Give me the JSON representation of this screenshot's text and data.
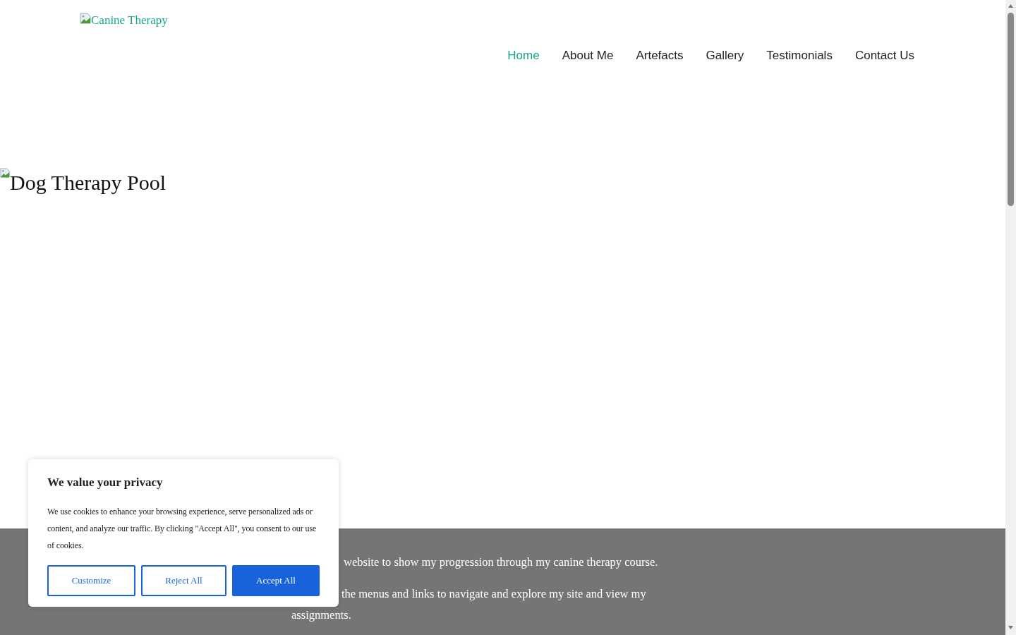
{
  "header": {
    "logo_alt": "Canine Therapy",
    "nav": [
      {
        "label": "Home",
        "selected": true
      },
      {
        "label": "About Me",
        "selected": false
      },
      {
        "label": "Artefacts",
        "selected": false
      },
      {
        "label": "Gallery",
        "selected": false
      },
      {
        "label": "Testimonials",
        "selected": false
      },
      {
        "label": "Contact Us",
        "selected": false
      }
    ]
  },
  "hero": {
    "image_alt": "Dog Therapy Pool"
  },
  "intro": {
    "paragraphs": [
      "website to show my progression through my canine therapy course.",
      "the menus and links to navigate and explore my site and view my assignments."
    ]
  },
  "cookie_banner": {
    "title": "We value your privacy",
    "text": "We use cookies to enhance your browsing experience, serve personalized ads or content, and analyze our traffic. By clicking \"Accept All\", you consent to our use of cookies.",
    "buttons": [
      {
        "label": "Customize",
        "kind": "outline"
      },
      {
        "label": "Reject All",
        "kind": "outline"
      },
      {
        "label": "Accept All",
        "kind": "primary"
      }
    ]
  }
}
